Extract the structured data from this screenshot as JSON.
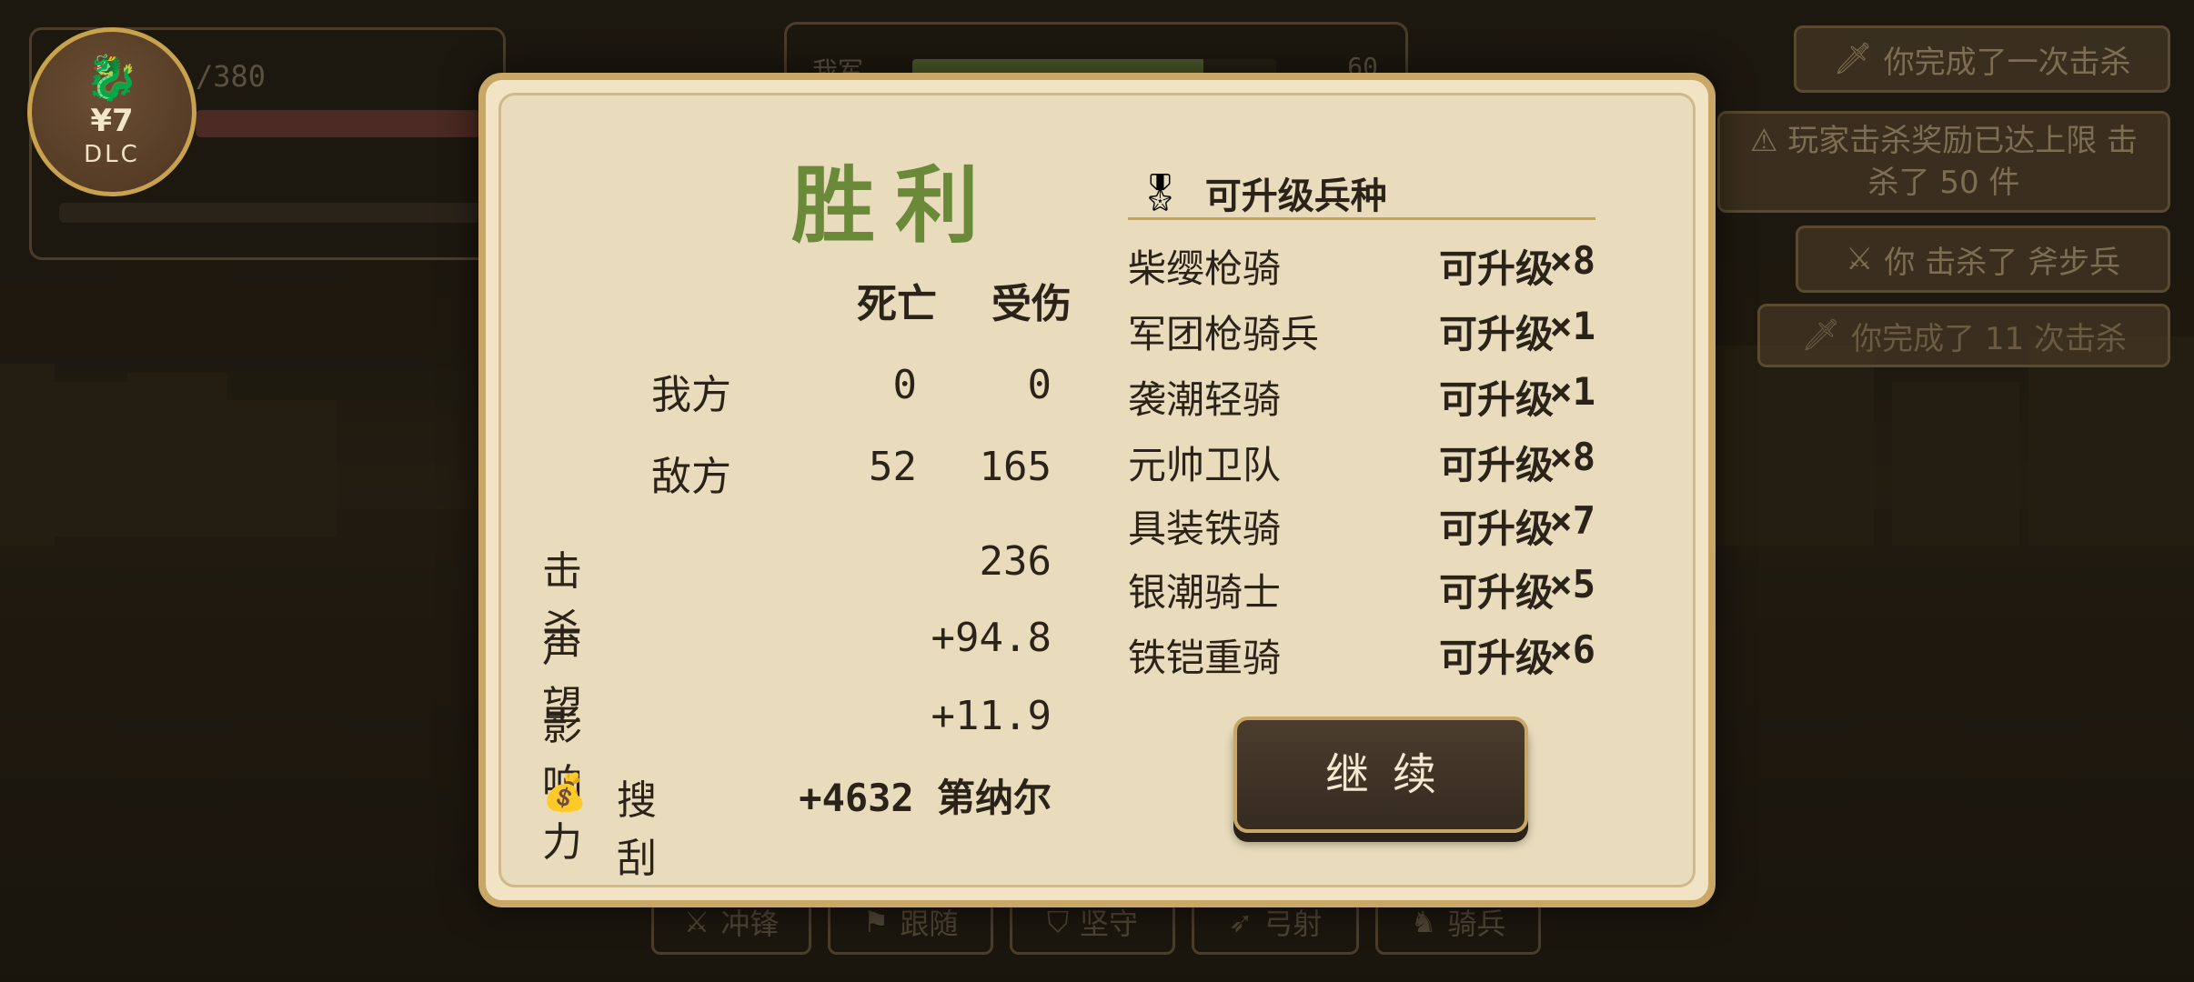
{
  "hud": {
    "dlc": {
      "price": "¥7",
      "label": "DLC"
    },
    "troop_count": "/380",
    "army": {
      "label": "我军",
      "value": "60",
      "fill": 0.8
    }
  },
  "notifications": [
    {
      "icon": "sword",
      "text": "你完成了一次击杀"
    },
    {
      "icon": "warning",
      "text": "⚠ 玩家击杀奖励已达上限 击杀了 50 件"
    },
    {
      "icon": "crossed-swords",
      "text": "你 击杀了 斧步兵"
    },
    {
      "icon": "sword",
      "text": "你完成了 11 次击杀"
    }
  ],
  "commands": [
    {
      "icon": "crossed-swords",
      "label": "冲锋"
    },
    {
      "icon": "flag",
      "label": "跟随"
    },
    {
      "icon": "shield",
      "label": "坚守"
    },
    {
      "icon": "bow",
      "label": "弓射"
    },
    {
      "icon": "horse",
      "label": "骑兵"
    }
  ],
  "dialog": {
    "title": "胜利",
    "headers": {
      "death": "死亡",
      "wound": "受伤"
    },
    "ally": {
      "label": "我方",
      "death": "0",
      "wound": "0"
    },
    "enemy": {
      "label": "敌方",
      "death": "52",
      "wound": "165"
    },
    "kills": {
      "label": "击杀",
      "value": "236"
    },
    "fame": {
      "label": "声望",
      "value": "+94.8"
    },
    "influence": {
      "label": "影响力",
      "value": "+11.9"
    },
    "loot": {
      "label": "搜刮",
      "value": "+4632 第纳尔"
    },
    "upgrade_title": "可升级兵种",
    "upgrade_status": "可升级",
    "units": [
      {
        "name": "柴缨枪骑",
        "count": "×8"
      },
      {
        "name": "军团枪骑兵",
        "count": "×1"
      },
      {
        "name": "袭潮轻骑",
        "count": "×1"
      },
      {
        "name": "元帅卫队",
        "count": "×8"
      },
      {
        "name": "具装铁骑",
        "count": "×7"
      },
      {
        "name": "银潮骑士",
        "count": "×5"
      },
      {
        "name": "铁铠重骑",
        "count": "×6"
      }
    ],
    "continue_label": "继续"
  }
}
